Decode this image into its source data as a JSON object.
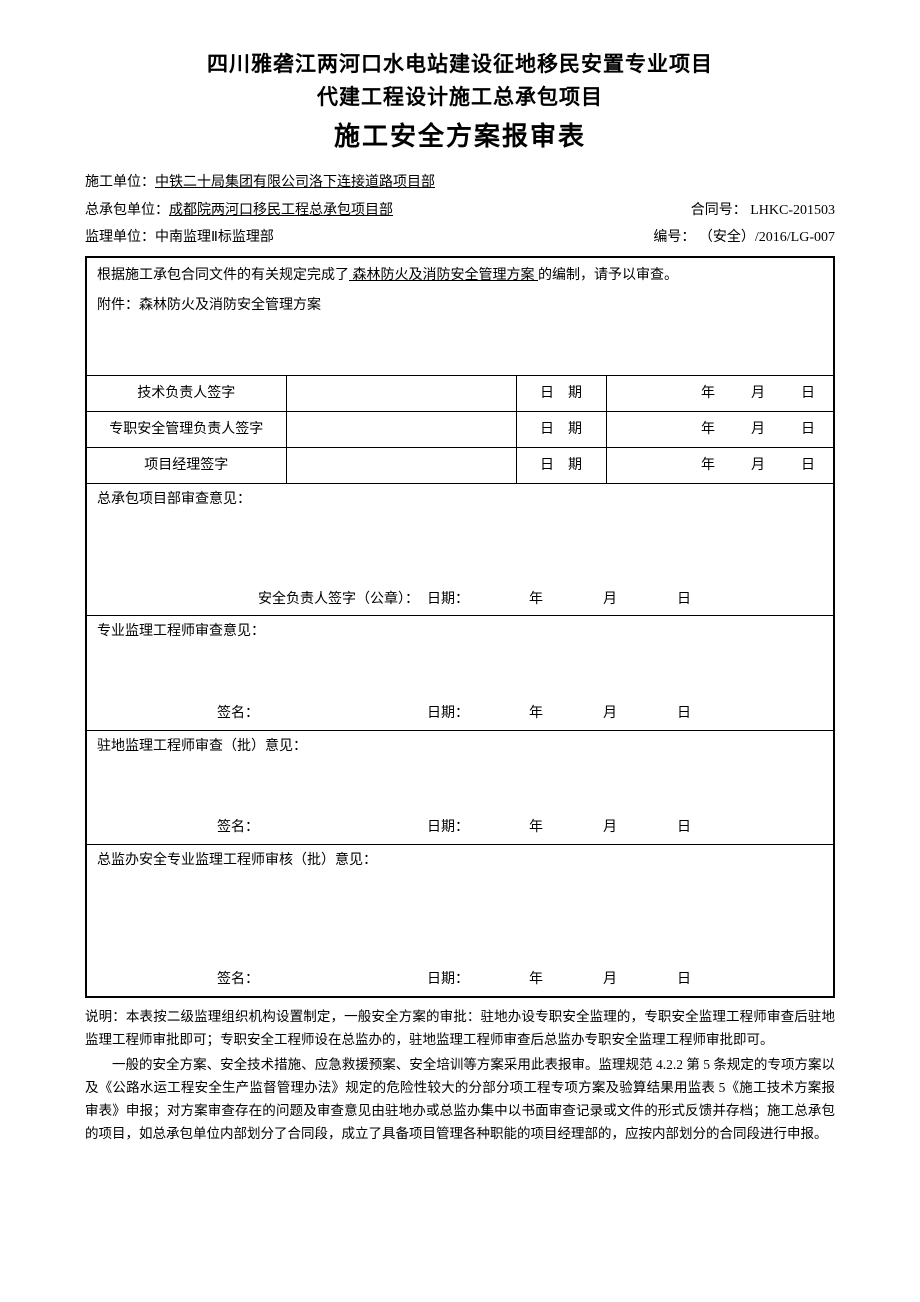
{
  "header": {
    "line1": "四川雅砻江两河口水电站建设征地移民安置专业项目",
    "line2": "代建工程设计施工总承包项目",
    "form_title": "施工安全方案报审表"
  },
  "info": {
    "construction_unit_label": "施工单位：",
    "construction_unit_value": "中铁二十局集团有限公司洛下连接道路项目部",
    "general_contract_label": "总承包单位：",
    "general_contract_value": "成都院两河口移民工程总承包项目部",
    "contract_no_label": "合同号：",
    "contract_no_value": "LHKC-201503",
    "supervision_unit_label": "监理单位：",
    "supervision_unit_value": "中南监理Ⅱ标监理部",
    "serial_label": "编号：",
    "serial_value": "（安全）/2016/LG-007"
  },
  "body": {
    "intro_prefix": "根据施工承包合同文件的有关规定完成了",
    "intro_scheme": " 森林防火及消防安全管理方案 ",
    "intro_suffix": "的编制，请予以审查。",
    "attachment_label": "附件：",
    "attachment_value": "森林防火及消防安全管理方案"
  },
  "sig_rows": [
    {
      "label": "技术负责人签字",
      "date_label": "日　期"
    },
    {
      "label": "专职安全管理负责人签字",
      "date_label": "日　期"
    },
    {
      "label": "项目经理签字",
      "date_label": "日　期"
    }
  ],
  "date_units": {
    "year": "年",
    "month": "月",
    "day": "日"
  },
  "opinions": [
    {
      "title": "总承包项目部审查意见：",
      "sig_label": "安全负责人签字（公章）：",
      "date_label": "日期："
    },
    {
      "title": "专业监理工程师审查意见：",
      "sig_label": "签名：",
      "date_label": "日期："
    },
    {
      "title": "驻地监理工程师审查（批）意见：",
      "sig_label": "签名：",
      "date_label": "日期："
    },
    {
      "title": "总监办安全专业监理工程师审核（批）意见：",
      "sig_label": "签名：",
      "date_label": "日期："
    }
  ],
  "notes": {
    "p1": "说明：本表按二级监理组织机构设置制定，一般安全方案的审批：驻地办设专职安全监理的，专职安全监理工程师审查后驻地监理工程师审批即可；专职安全工程师设在总监办的，驻地监理工程师审查后总监办专职安全监理工程师审批即可。",
    "p2": "一般的安全方案、安全技术措施、应急救援预案、安全培训等方案采用此表报审。监理规范 4.2.2 第 5 条规定的专项方案以及《公路水运工程安全生产监督管理办法》规定的危险性较大的分部分项工程专项方案及验算结果用监表 5《施工技术方案报审表》申报；对方案审查存在的问题及审查意见由驻地办或总监办集中以书面审查记录或文件的形式反馈并存档；施工总承包的项目，如总承包单位内部划分了合同段，成立了具备项目管理各种职能的项目经理部的，应按内部划分的合同段进行申报。"
  }
}
